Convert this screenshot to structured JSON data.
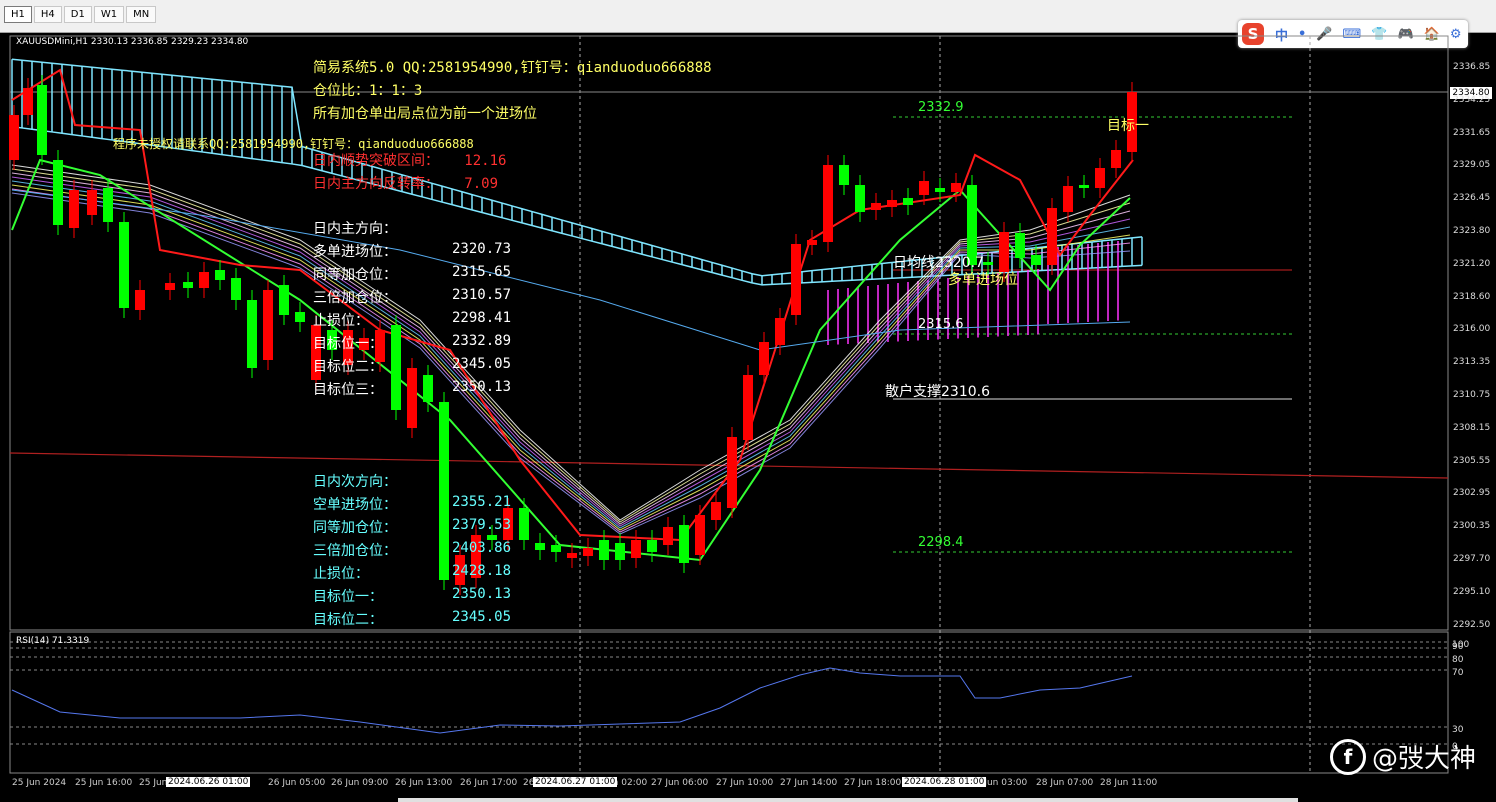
{
  "toolbar": {
    "timeframes": [
      "H1",
      "H4",
      "D1",
      "W1",
      "MN"
    ],
    "active": "H1"
  },
  "ime": {
    "logo": "S",
    "items": [
      "中",
      "•",
      "🎤",
      "⌨",
      "👕",
      "🎮",
      "🏠",
      "⚙"
    ]
  },
  "header": {
    "symbol_info": "XAUUSDMini,H1  2330.13 2336.85 2329.23 2334.80"
  },
  "current_price": "2334.80",
  "price_axis": [
    "2336.85",
    "2334.25",
    "2331.65",
    "2329.05",
    "2326.45",
    "2323.80",
    "2321.20",
    "2318.60",
    "2316.00",
    "2313.35",
    "2310.75",
    "2308.15",
    "2305.55",
    "2302.95",
    "2300.35",
    "2297.70",
    "2295.10",
    "2292.50"
  ],
  "rsi": {
    "label": "RSI(14) 71.3319",
    "levels": [
      "100",
      "90",
      "80",
      "70",
      "30",
      "0"
    ]
  },
  "panel": {
    "line1": "简易系统5.0 QQ:2581954990,钉钉号：qianduoduo666888",
    "line2": "仓位比：1：1：3",
    "line3": "所有加仓单出局点位为前一个进场位",
    "warning": "程序未授权请联系QQ:2581954990,钉钉号：qianduoduo666888",
    "breakout": "日内顺势突破区间：   12.16",
    "reversal": "日内主方向反转率：   7.09",
    "main_title": "日内主方向：",
    "main": [
      [
        "多单进场位：",
        "2320.73"
      ],
      [
        "同等加仓位：",
        "2315.65"
      ],
      [
        "三倍加仓位：",
        "2310.57"
      ],
      [
        "止损位：",
        "2298.41"
      ],
      [
        "目标位一：",
        "2332.89"
      ],
      [
        "目标位二：",
        "2345.05"
      ],
      [
        "目标位三：",
        "2350.13"
      ]
    ],
    "sub_title": "日内次方向：",
    "sub": [
      [
        "空单进场位：",
        "2355.21"
      ],
      [
        "同等加仓位：",
        "2379.53"
      ],
      [
        "三倍加仓位：",
        "2403.86"
      ],
      [
        "止损位：",
        "2428.18"
      ],
      [
        "目标位一：",
        "2350.13"
      ],
      [
        "目标位二：",
        "2345.05"
      ]
    ]
  },
  "annotations": {
    "t1_value": "2332.9",
    "t1_label": "目标一",
    "daily_avg": "日均线2320.7",
    "long_entry": "多单进场位",
    "level_2315": "2315.6",
    "retail_support": "散户支撑2310.6",
    "level_2298": "2298.4"
  },
  "time_axis": [
    "25 Jun 2024",
    "25 Jun 16:00",
    "25 Jun",
    "26 Jun 05:00",
    "26 Jun 09:00",
    "26 Jun 13:00",
    "26 Jun 17:00",
    "26",
    "27 Jun 02:00",
    "27 Jun 06:00",
    "27 Jun 10:00",
    "27 Jun 14:00",
    "27 Jun 18:00",
    "28 Jun 03:00",
    "28 Jun 07:00",
    "28 Jun 11:00"
  ],
  "time_boxes": [
    "2024.06.26 01:00",
    "2024.06.27 01:00",
    "2024.06.28 01:00"
  ],
  "watermark": {
    "handle": "@弢大神"
  },
  "colors": {
    "bull": "#00ff00",
    "bear": "#ff0000",
    "cloud": "#7fe6ff",
    "purple": "#ff33ff",
    "panel_yellow": "#ffff66",
    "panel_cyan": "#66ffff",
    "panel_red": "#ff3030",
    "panel_white": "#ffffff"
  }
}
